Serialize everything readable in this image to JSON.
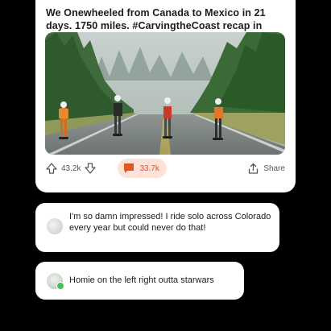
{
  "post": {
    "title": "We Onewheeled from Canada to Mexico in 21 days. 1750 miles. #CarvingtheCoast recap in comments.",
    "image_alt": "Four riders on Onewheels on a forested highway",
    "upvotes": "43.2k",
    "comments": "33.7k",
    "share_label": "Share"
  },
  "comments": [
    {
      "text": "I'm so damn impressed! I ride solo across Colorado every year but could never do that!",
      "online": false
    },
    {
      "text": "Homie on the left right outta starwars",
      "online": true
    }
  ],
  "colors": {
    "accent": "#e8541e",
    "comment_pill_bg": "#fde2d7",
    "online": "#46c15a"
  }
}
